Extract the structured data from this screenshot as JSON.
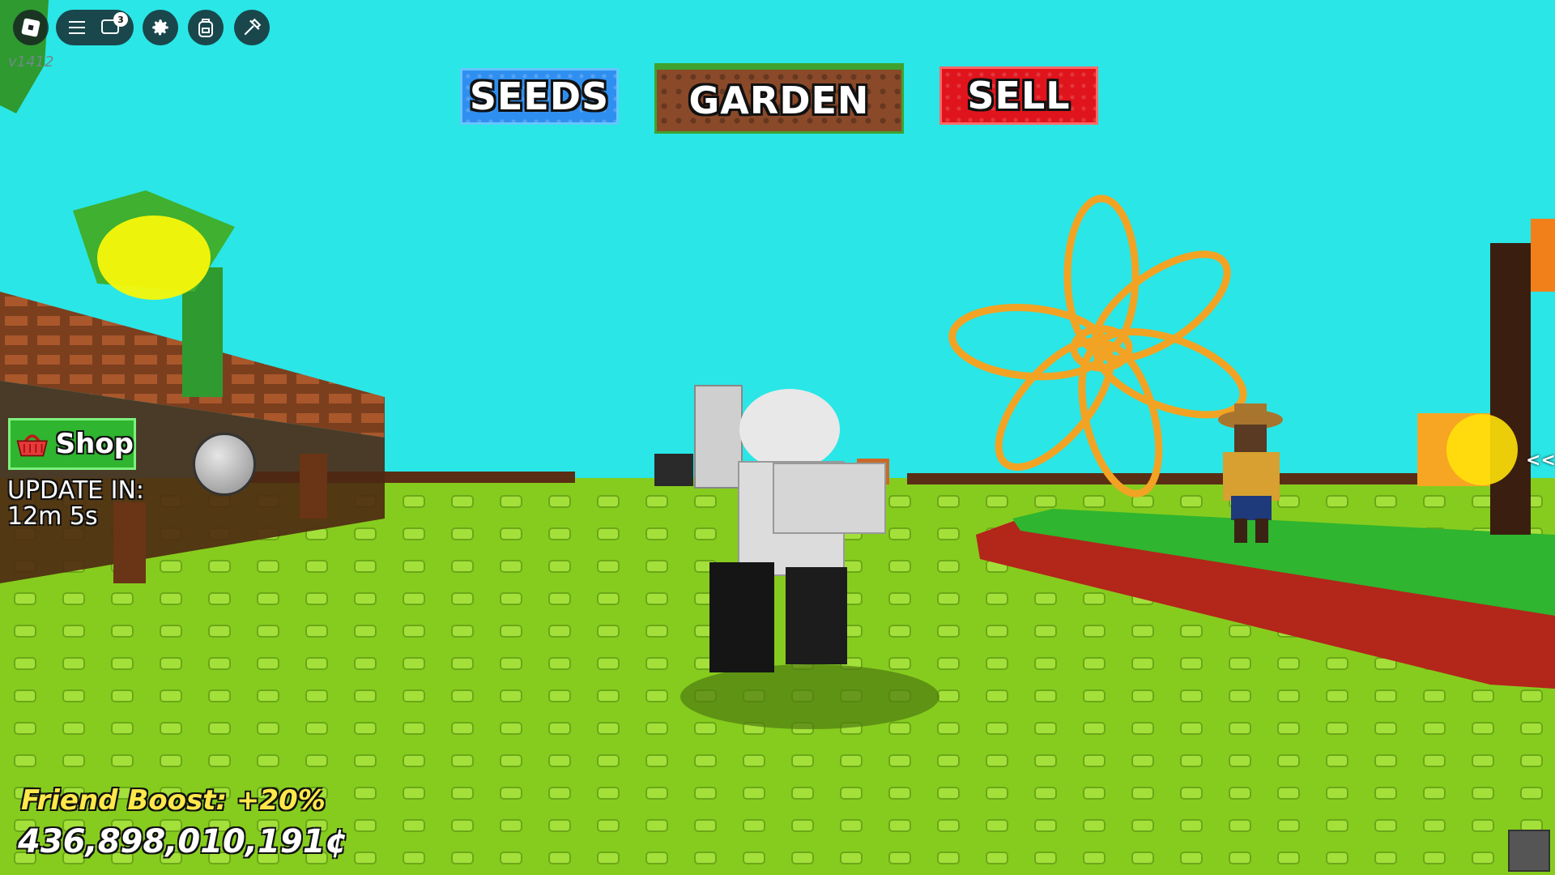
{
  "roblox_bar": {
    "version": "v1412",
    "chat_badge": "3",
    "icons": [
      "roblox-logo-icon",
      "menu-icon",
      "chat-icon",
      "gear-icon",
      "backpack-icon",
      "tools-icon"
    ]
  },
  "nav": {
    "seeds_label": "SEEDS",
    "garden_label": "GARDEN",
    "sell_label": "SELL"
  },
  "shop": {
    "label": "Shop",
    "update_line1": "UPDATE IN:",
    "update_line2": "12m 5s"
  },
  "stats": {
    "friend_boost": "Friend Boost: +20%",
    "money": "436,898,010,191¢"
  },
  "side_panel": {
    "collapse_label": "<<"
  },
  "colors": {
    "sky": "#2ae6e6",
    "grass": "#86cc1e",
    "seeds": "#2f8ff0",
    "garden": "#8a4a2a",
    "sell": "#e0141c",
    "shop": "#2fb52f",
    "boost": "#ffe84a"
  }
}
